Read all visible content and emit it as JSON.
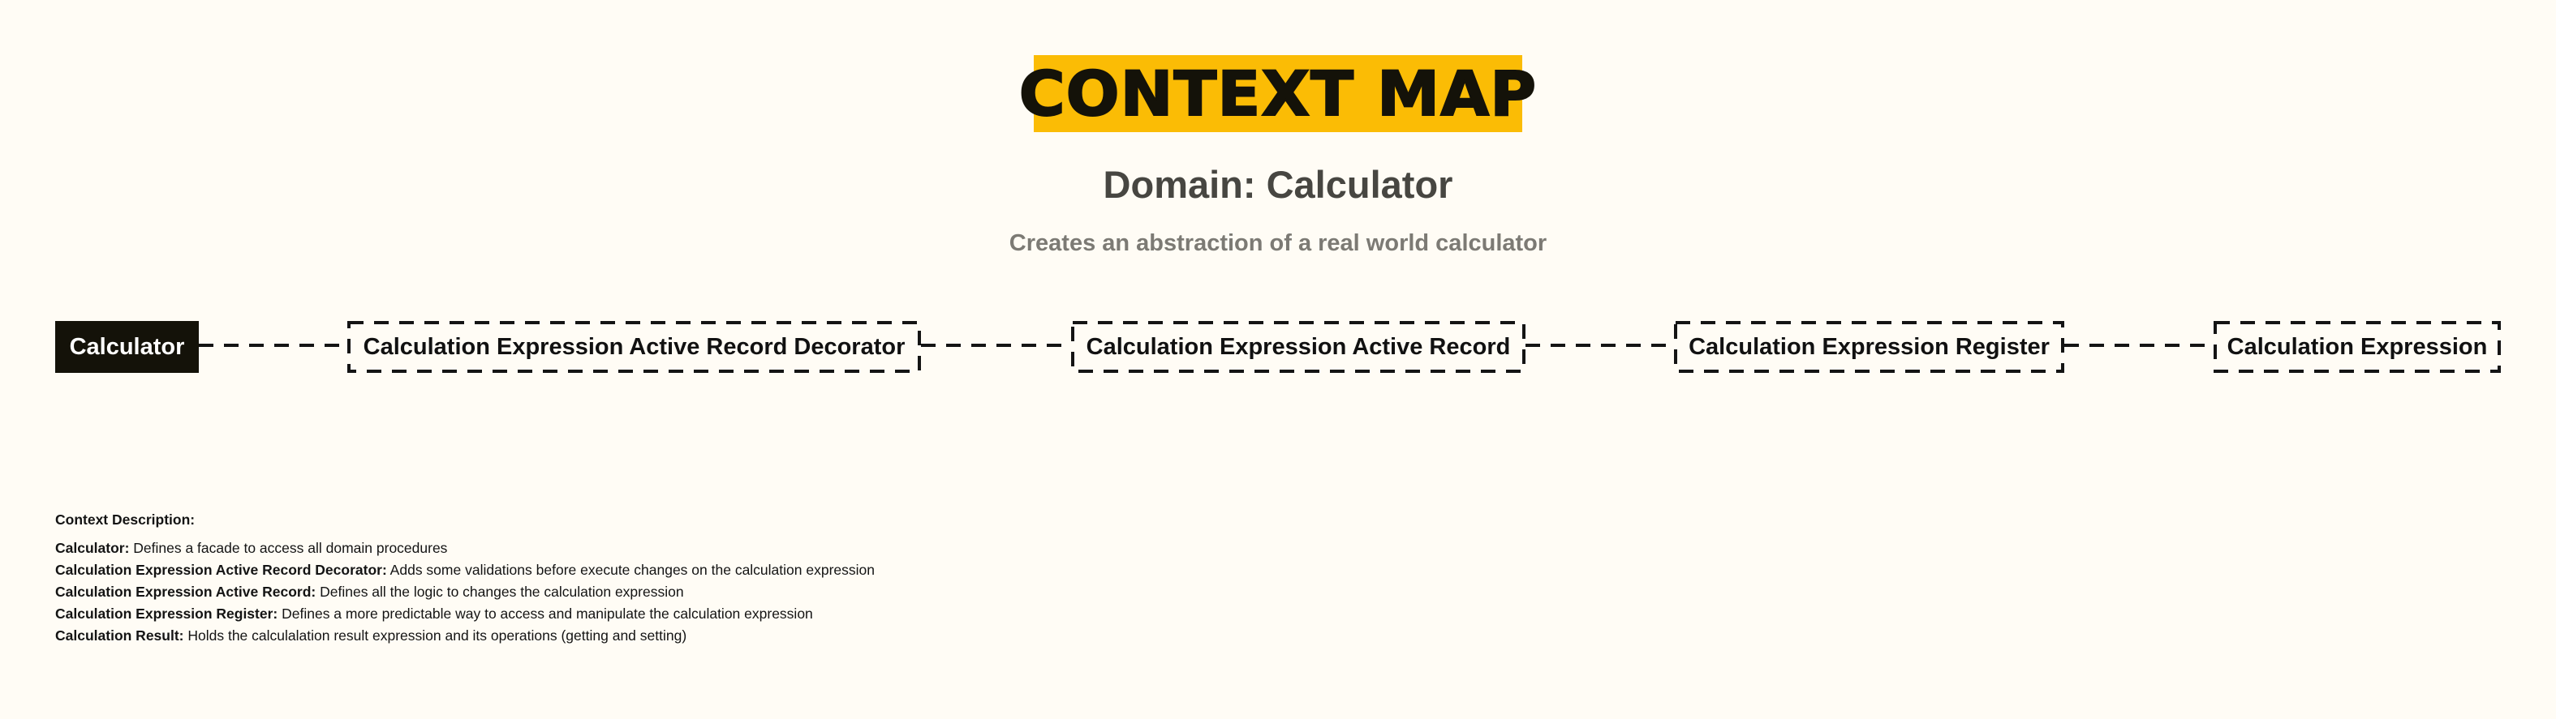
{
  "title": "CONTEXT MAP",
  "domain_title": "Domain: Calculator",
  "subtitle": "Creates an abstraction of a real world calculator",
  "nodes": [
    {
      "label": "Calculator",
      "style": "solid"
    },
    {
      "label": "Calculation Expression Active Record Decorator",
      "style": "dashed"
    },
    {
      "label": "Calculation Expression Active Record",
      "style": "dashed"
    },
    {
      "label": "Calculation Expression Register",
      "style": "dashed"
    },
    {
      "label": "Calculation Expression",
      "style": "dashed"
    }
  ],
  "description": {
    "heading": "Context Description:",
    "items": [
      {
        "term": "Calculator:",
        "text": " Defines a facade to access all domain procedures"
      },
      {
        "term": "Calculation Expression Active Record Decorator:",
        "text": " Adds some validations before execute changes on the calculation expression"
      },
      {
        "term": "Calculation Expression Active Record:",
        "text": " Defines all the logic to changes the calculation expression"
      },
      {
        "term": "Calculation Expression Register:",
        "text": " Defines a more predictable way to access and manipulate the calculation expression"
      },
      {
        "term": "Calculation Result:",
        "text": " Holds the calculalation result expression and its operations (getting and setting)"
      }
    ]
  },
  "colors": {
    "accent": "#fbbc05",
    "ink": "#141209",
    "background": "#fffcf5"
  }
}
